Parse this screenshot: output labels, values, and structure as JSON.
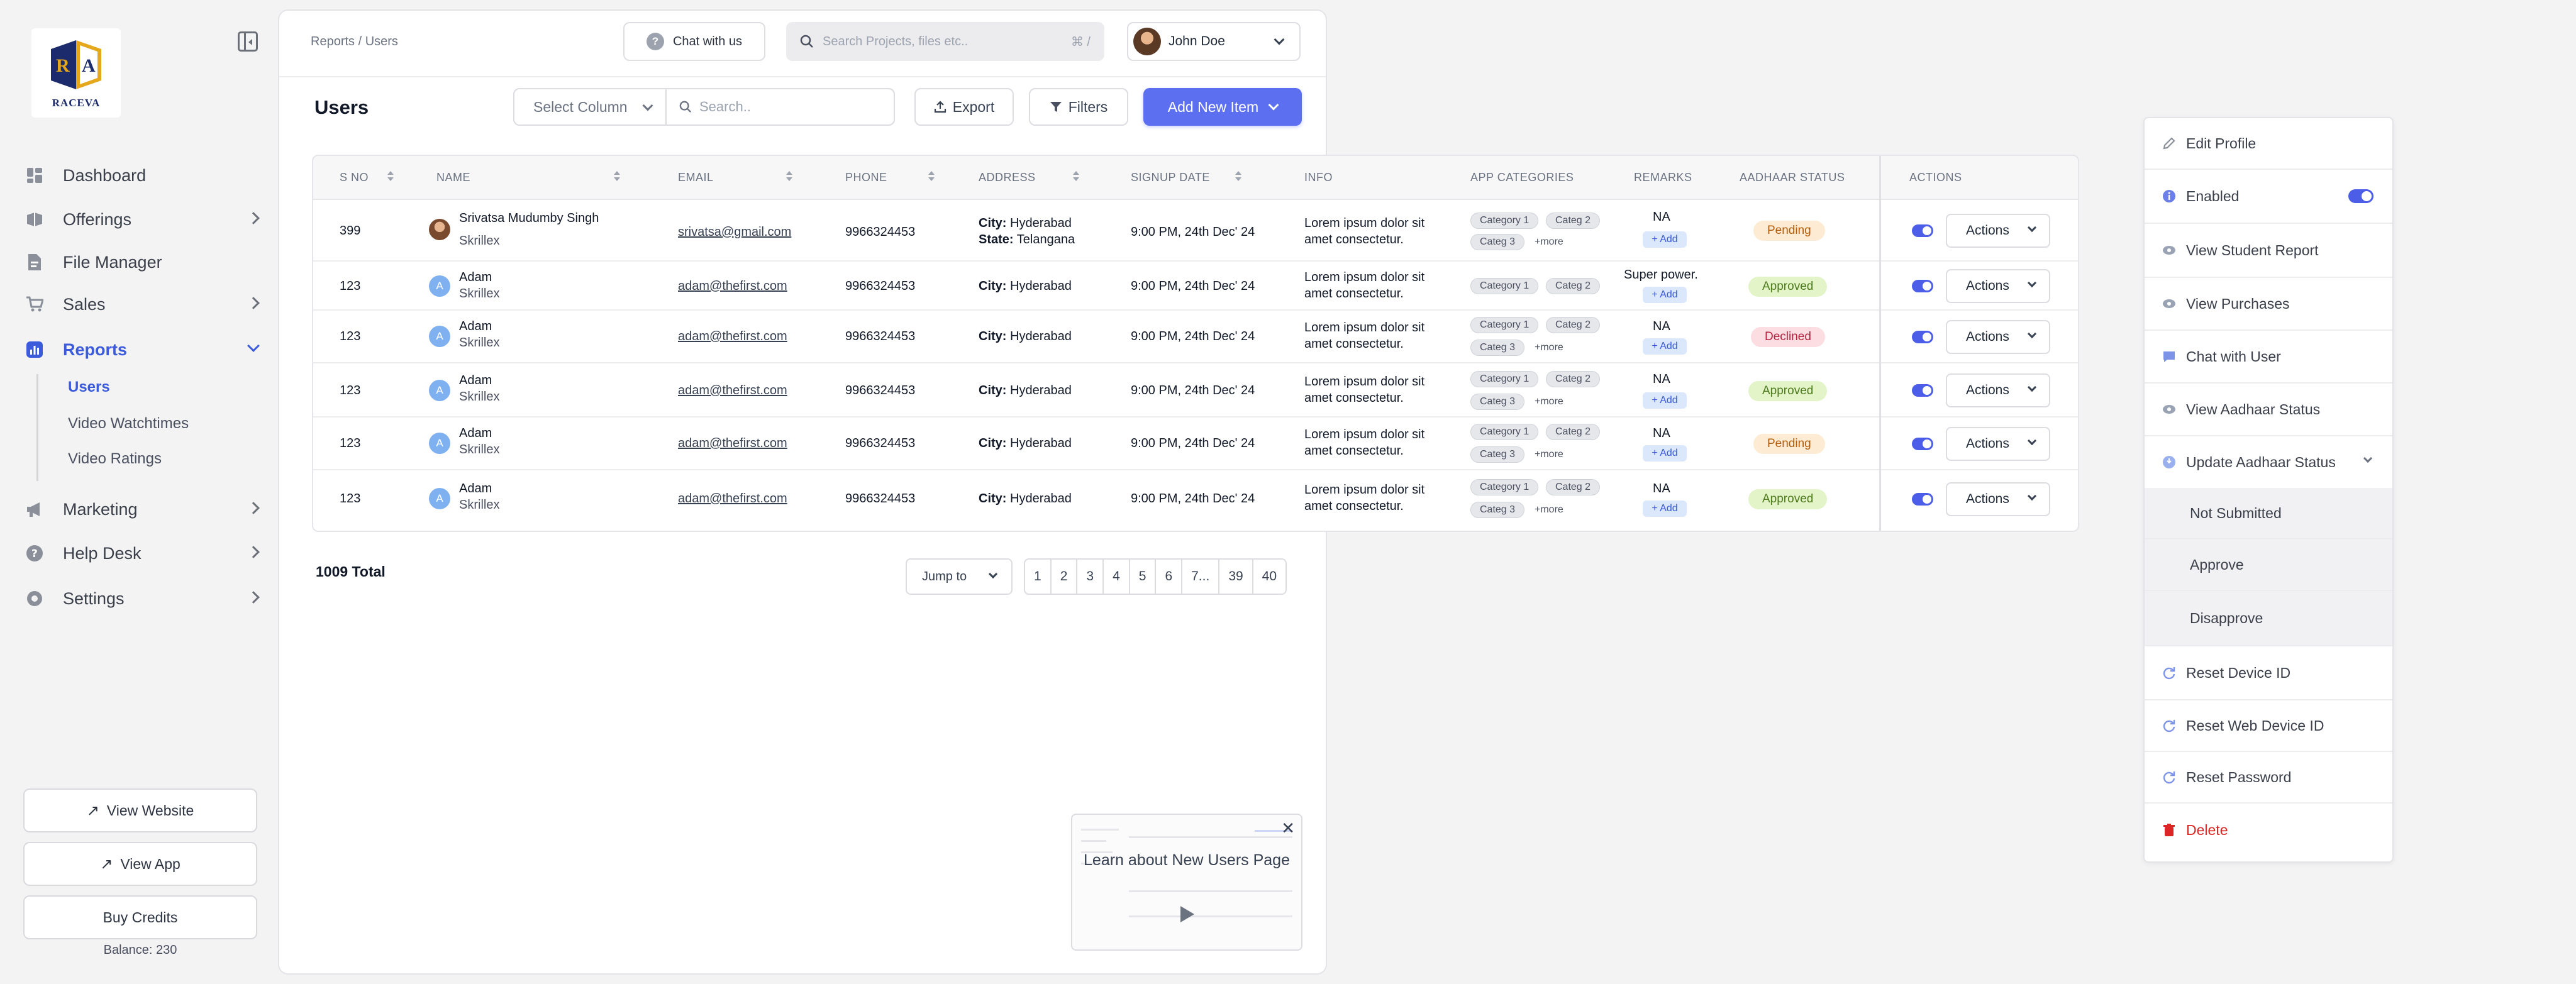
{
  "brand": {
    "name": "RACEVA",
    "mark_letters": "RA"
  },
  "sidebar": {
    "items": [
      {
        "label": "Dashboard"
      },
      {
        "label": "Offerings"
      },
      {
        "label": "File Manager"
      },
      {
        "label": "Sales"
      },
      {
        "label": "Reports"
      },
      {
        "label": "Marketing"
      },
      {
        "label": "Help Desk"
      },
      {
        "label": "Settings"
      }
    ],
    "reports_sub": [
      "Users",
      "Video Watchtimes",
      "Video Ratings"
    ],
    "buttons": {
      "view_website": "View Website",
      "view_app": "View App",
      "buy_credits": "Buy Credits"
    },
    "balance": "Balance: 230"
  },
  "topbar": {
    "breadcrumb": "Reports / Users",
    "chat": "Chat with us",
    "search_placeholder": "Search Projects, files etc..",
    "shortcut": "⌘ /",
    "user_name": "John Doe"
  },
  "toolbar": {
    "title": "Users",
    "select_column": "Select Column",
    "search_placeholder": "Search..",
    "export": "Export",
    "filters": "Filters",
    "add_new": "Add New Item"
  },
  "table": {
    "headers": {
      "sno": "S NO",
      "name": "NAME",
      "email": "EMAIL",
      "phone": "PHONE",
      "address": "ADDRESS",
      "signup": "SIGNUP DATE",
      "info": "INFO",
      "categories": "APP CATEGORIES",
      "remarks": "REMARKS",
      "aadhaar": "AADHAAR STATUS",
      "actions": "ACTIONS"
    },
    "rows": [
      {
        "sno": "399",
        "avatar": "",
        "name": "Srivatsa Mudumby Singh",
        "company": "Skrillex",
        "email": "srivatsa@gmail.com",
        "phone": "9966324453",
        "city_label": "City:",
        "city": " Hyderabad",
        "state_label": "State:",
        "state": " Telangana",
        "signup": "9:00 PM, 24th Dec' 24",
        "info1": "Lorem ipsum dolor sit",
        "info2": "amet consectetur.",
        "cat1": "Category 1",
        "cat2": "Categ 2",
        "cat3": "Categ 3",
        "more": "+more",
        "remark": "NA",
        "add": "+ Add",
        "status": "Pending",
        "actions": "Actions"
      },
      {
        "sno": "123",
        "avatar": "A",
        "name": "Adam",
        "company": "Skrillex",
        "email": "adam@thefirst.com",
        "phone": "9966324453",
        "city_label": "City:",
        "city": " Hyderabad",
        "signup": "9:00 PM, 24th Dec' 24",
        "info1": "Lorem ipsum dolor sit",
        "info2": "amet consectetur.",
        "cat1": "Category 1",
        "cat2": "Categ 2",
        "remark": "Super power.",
        "add": "+ Add",
        "status": "Approved",
        "actions": "Actions"
      },
      {
        "sno": "123",
        "avatar": "A",
        "name": "Adam",
        "company": "Skrillex",
        "email": "adam@thefirst.com",
        "phone": "9966324453",
        "city_label": "City:",
        "city": " Hyderabad",
        "signup": "9:00 PM, 24th Dec' 24",
        "info1": "Lorem ipsum dolor sit",
        "info2": "amet consectetur.",
        "cat1": "Category 1",
        "cat2": "Categ 2",
        "cat3": "Categ 3",
        "more": "+more",
        "remark": "NA",
        "add": "+ Add",
        "status": "Declined",
        "actions": "Actions"
      },
      {
        "sno": "123",
        "avatar": "A",
        "name": "Adam",
        "company": "Skrillex",
        "email": "adam@thefirst.com",
        "phone": "9966324453",
        "city_label": "City:",
        "city": " Hyderabad",
        "signup": "9:00 PM, 24th Dec' 24",
        "info1": "Lorem ipsum dolor sit",
        "info2": "amet consectetur.",
        "cat1": "Category 1",
        "cat2": "Categ 2",
        "cat3": "Categ 3",
        "more": "+more",
        "remark": "NA",
        "add": "+ Add",
        "status": "Approved",
        "actions": "Actions"
      },
      {
        "sno": "123",
        "avatar": "A",
        "name": "Adam",
        "company": "Skrillex",
        "email": "adam@thefirst.com",
        "phone": "9966324453",
        "city_label": "City:",
        "city": " Hyderabad",
        "signup": "9:00 PM, 24th Dec' 24",
        "info1": "Lorem ipsum dolor sit",
        "info2": "amet consectetur.",
        "cat1": "Category 1",
        "cat2": "Categ 2",
        "cat3": "Categ 3",
        "more": "+more",
        "remark": "NA",
        "add": "+ Add",
        "status": "Pending",
        "actions": "Actions"
      },
      {
        "sno": "123",
        "avatar": "A",
        "name": "Adam",
        "company": "Skrillex",
        "email": "adam@thefirst.com",
        "phone": "9966324453",
        "city_label": "City:",
        "city": " Hyderabad",
        "signup": "9:00 PM, 24th Dec' 24",
        "info1": "Lorem ipsum dolor sit",
        "info2": "amet consectetur.",
        "cat1": "Category 1",
        "cat2": "Categ 2",
        "cat3": "Categ 3",
        "more": "+more",
        "remark": "NA",
        "add": "+ Add",
        "status": "Approved",
        "actions": "Actions"
      }
    ]
  },
  "footer": {
    "total": "1009 Total",
    "jump_to": "Jump to",
    "pages": [
      "1",
      "2",
      "3",
      "4",
      "5",
      "6",
      "7...",
      "39",
      "40"
    ]
  },
  "video_card": {
    "title": "Learn about New Users Page"
  },
  "action_menu": {
    "edit_profile": "Edit Profile",
    "enabled": "Enabled",
    "view_student_report": "View Student Report",
    "view_purchases": "View Purchases",
    "chat_with_user": "Chat with User",
    "view_aadhaar_status": "View Aadhaar Status",
    "update_aadhaar_status": "Update Aadhaar Status",
    "not_submitted": "Not Submitted",
    "approve": "Approve",
    "disapprove": "Disapprove",
    "reset_device_id": "Reset Device ID",
    "reset_web_device_id": "Reset Web Device ID",
    "reset_password": "Reset Password",
    "delete": "Delete"
  },
  "colors": {
    "accent": "#3b5bdb",
    "primary_button": "#5b6ff0",
    "danger": "#dc2626"
  }
}
